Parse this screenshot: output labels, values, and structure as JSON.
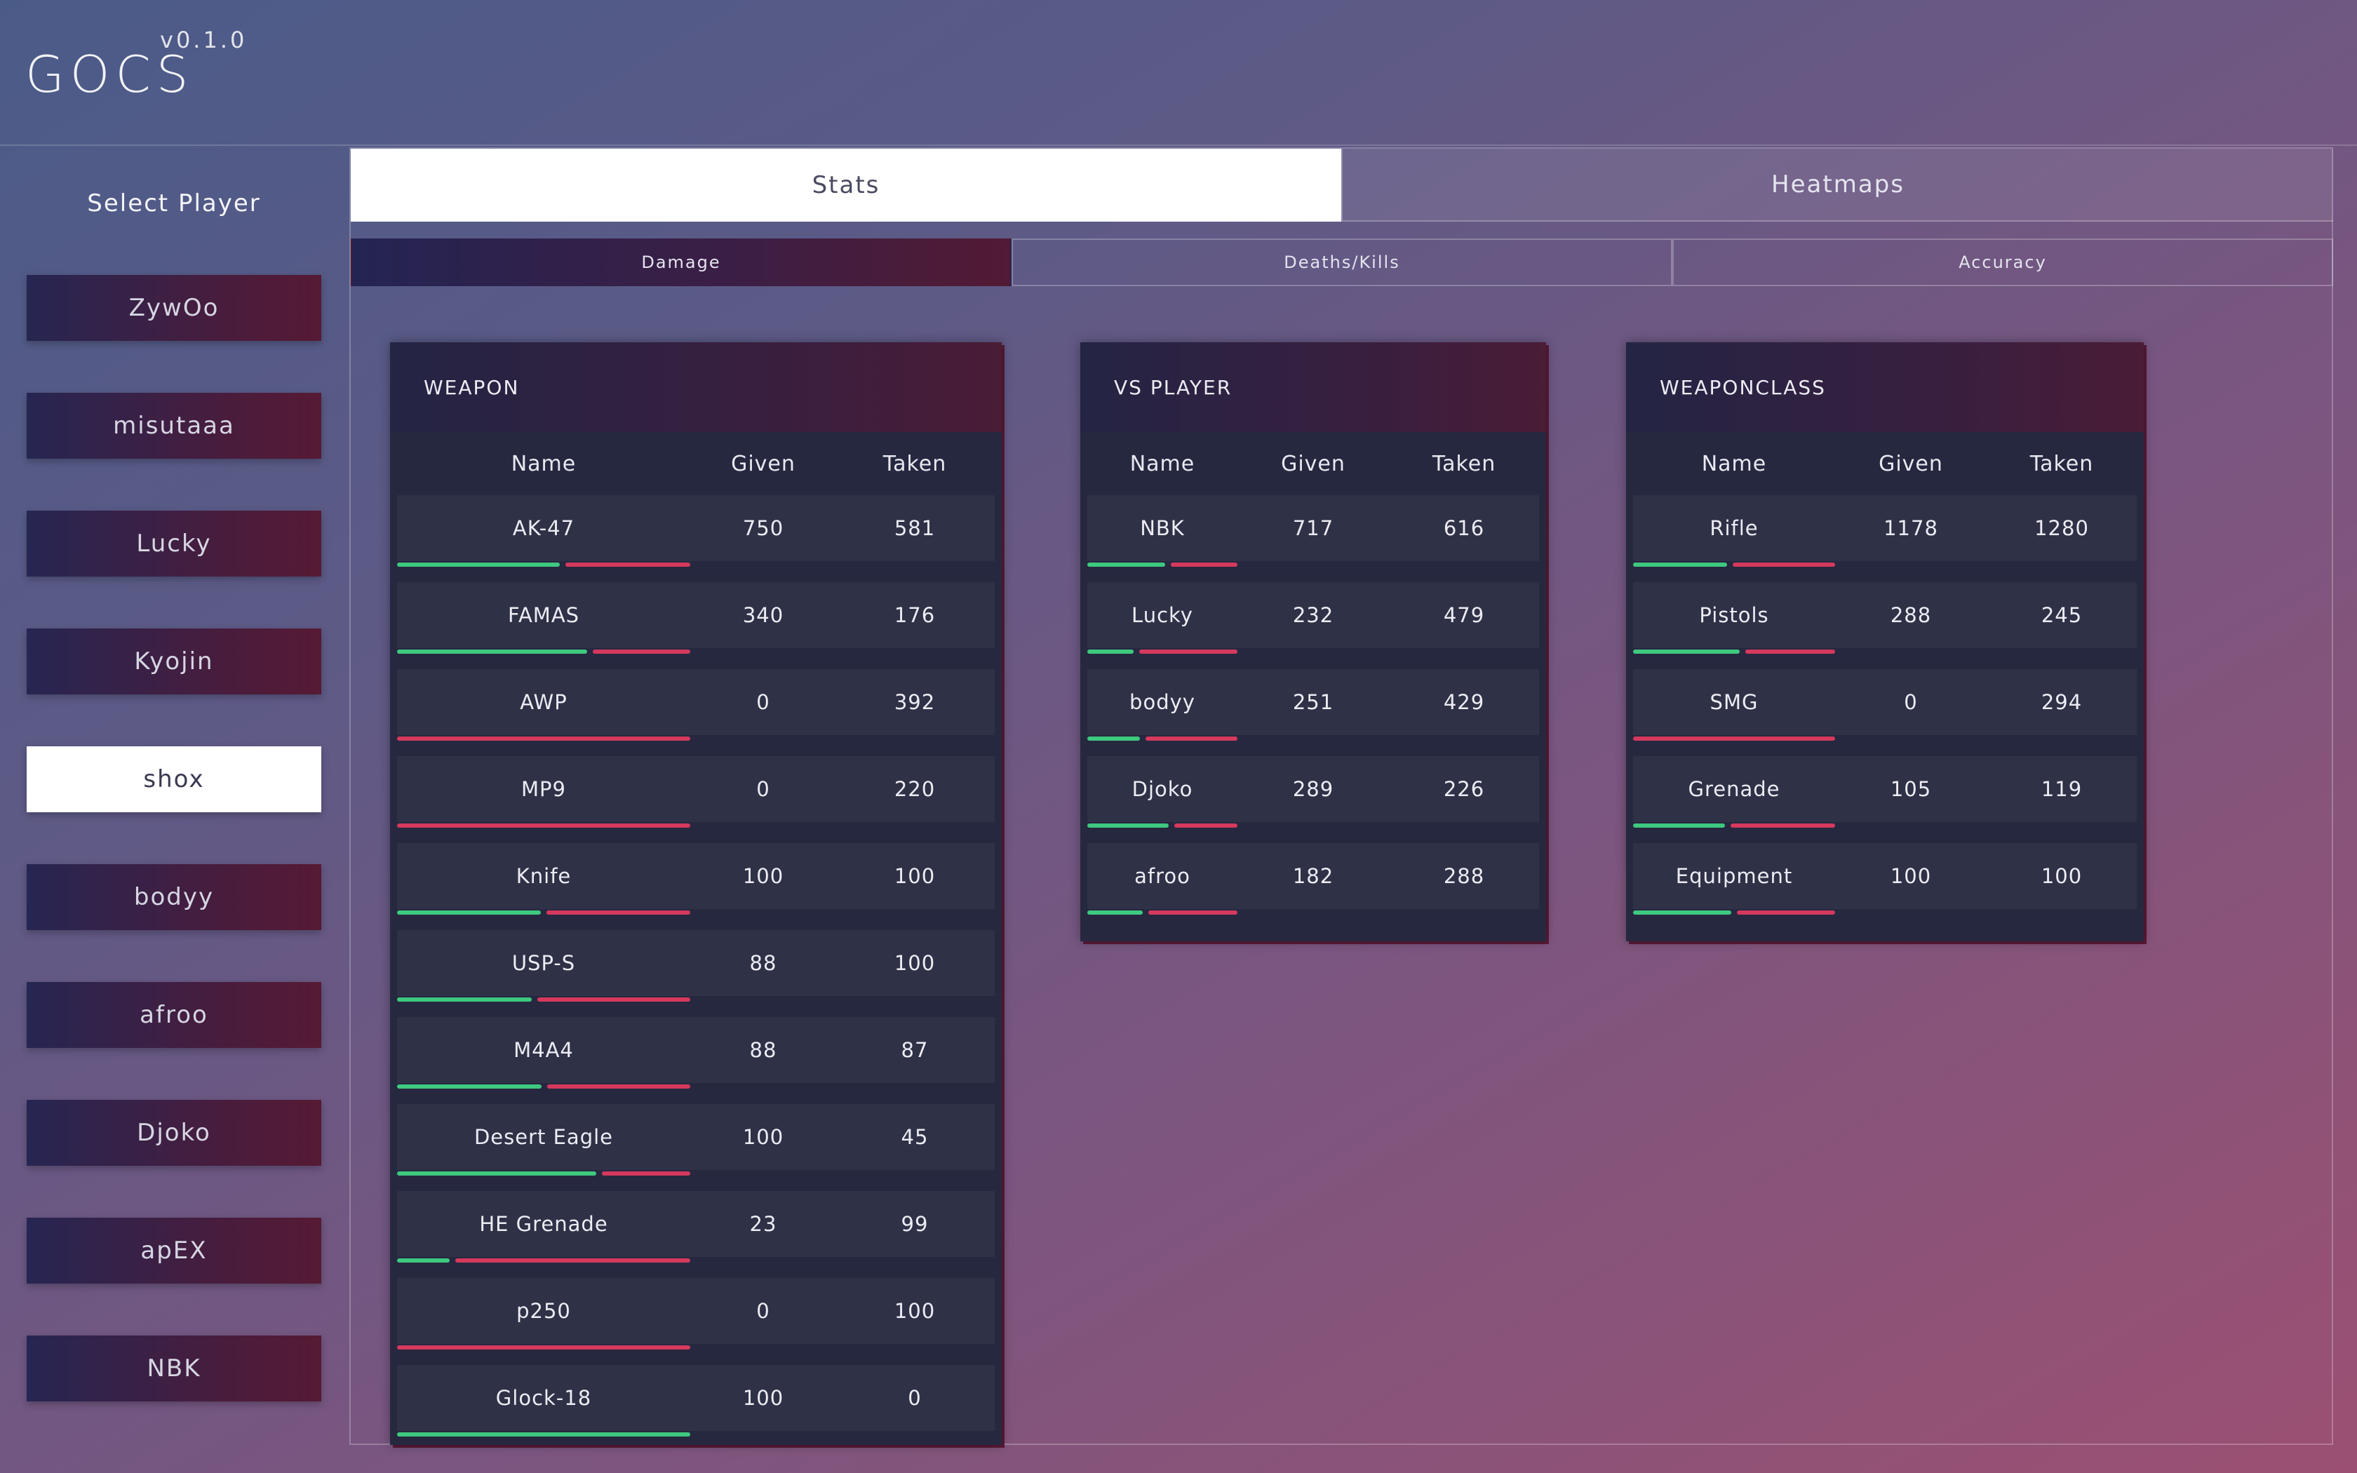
{
  "app": {
    "title": "GOCS",
    "version": "v0.1.0"
  },
  "sidebar": {
    "title": "Select Player",
    "players": [
      "ZywOo",
      "misutaaa",
      "Lucky",
      "Kyojin",
      "shox",
      "bodyy",
      "afroo",
      "Djoko",
      "apEX",
      "NBK"
    ],
    "active_player": "shox"
  },
  "tabs": [
    {
      "label": "Stats",
      "active": true
    },
    {
      "label": "Heatmaps",
      "active": false
    }
  ],
  "subtabs": [
    {
      "label": "Damage",
      "active": true
    },
    {
      "label": "Deaths/Kills",
      "active": false
    },
    {
      "label": "Accuracy",
      "active": false
    }
  ],
  "colors": {
    "given_bar": "#3ec97f",
    "taken_bar": "#d5395d"
  },
  "panels": [
    {
      "title": "WEAPON",
      "columns": [
        "Name",
        "Given",
        "Taken"
      ],
      "rows": [
        {
          "name": "AK-47",
          "given": 750,
          "taken": 581
        },
        {
          "name": "FAMAS",
          "given": 340,
          "taken": 176
        },
        {
          "name": "AWP",
          "given": 0,
          "taken": 392
        },
        {
          "name": "MP9",
          "given": 0,
          "taken": 220
        },
        {
          "name": "Knife",
          "given": 100,
          "taken": 100
        },
        {
          "name": "USP-S",
          "given": 88,
          "taken": 100
        },
        {
          "name": "M4A4",
          "given": 88,
          "taken": 87
        },
        {
          "name": "Desert Eagle",
          "given": 100,
          "taken": 45
        },
        {
          "name": "HE Grenade",
          "given": 23,
          "taken": 99
        },
        {
          "name": "p250",
          "given": 0,
          "taken": 100
        },
        {
          "name": "Glock-18",
          "given": 100,
          "taken": 0
        }
      ]
    },
    {
      "title": "VS PLAYER",
      "columns": [
        "Name",
        "Given",
        "Taken"
      ],
      "rows": [
        {
          "name": "NBK",
          "given": 717,
          "taken": 616
        },
        {
          "name": "Lucky",
          "given": 232,
          "taken": 479
        },
        {
          "name": "bodyy",
          "given": 251,
          "taken": 429
        },
        {
          "name": "Djoko",
          "given": 289,
          "taken": 226
        },
        {
          "name": "afroo",
          "given": 182,
          "taken": 288
        }
      ]
    },
    {
      "title": "WEAPONCLASS",
      "columns": [
        "Name",
        "Given",
        "Taken"
      ],
      "rows": [
        {
          "name": "Rifle",
          "given": 1178,
          "taken": 1280
        },
        {
          "name": "Pistols",
          "given": 288,
          "taken": 245
        },
        {
          "name": "SMG",
          "given": 0,
          "taken": 294
        },
        {
          "name": "Grenade",
          "given": 105,
          "taken": 119
        },
        {
          "name": "Equipment",
          "given": 100,
          "taken": 100
        }
      ]
    }
  ]
}
